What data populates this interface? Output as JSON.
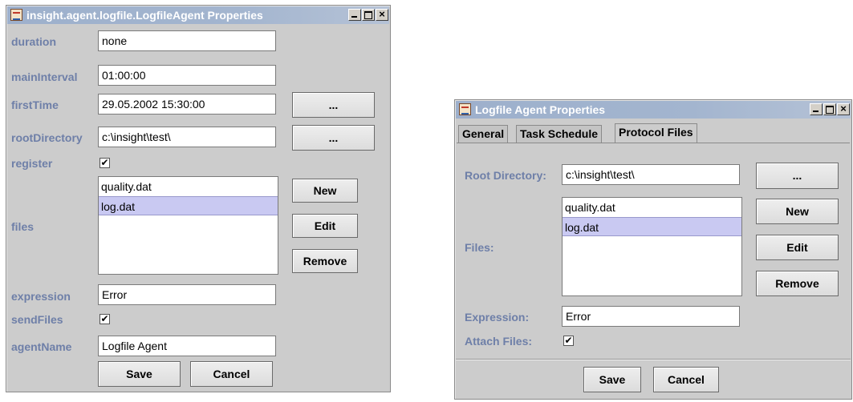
{
  "left_window": {
    "title": "insight.agent.logfile.LogfileAgent Properties",
    "controls": {
      "minimize": "_",
      "maximize": "□",
      "close": "×"
    },
    "labels": {
      "duration": "duration",
      "mainInterval": "mainInterval",
      "firstTime": "firstTime",
      "rootDirectory": "rootDirectory",
      "register": "register",
      "files": "files",
      "expression": "expression",
      "sendFiles": "sendFiles",
      "agentName": "agentName"
    },
    "values": {
      "duration": "none",
      "mainInterval": "01:00:00",
      "firstTime": "29.05.2002 15:30:00",
      "rootDirectory": "c:\\insight\\test\\",
      "expression": "Error",
      "agentName": "Logfile Agent"
    },
    "register_checked": "✔",
    "sendFiles_checked": "✔",
    "files": [
      "quality.dat",
      "log.dat"
    ],
    "selected_file": "log.dat",
    "buttons": {
      "browse_first_time": "...",
      "browse_root": "...",
      "new": "New",
      "edit": "Edit",
      "remove": "Remove",
      "save": "Save",
      "cancel": "Cancel"
    }
  },
  "right_window": {
    "title": "Logfile Agent Properties",
    "controls": {
      "minimize": "_",
      "maximize": "□",
      "close": "×"
    },
    "tabs": [
      "General",
      "Task Schedule",
      "Protocol Files"
    ],
    "active_tab": "Protocol Files",
    "labels": {
      "root_directory": "Root Directory:",
      "files": "Files:",
      "expression": "Expression:",
      "attach_files": "Attach Files:"
    },
    "values": {
      "root_directory": "c:\\insight\\test\\",
      "expression": "Error"
    },
    "attach_files_checked": "✔",
    "files": [
      "quality.dat",
      "log.dat"
    ],
    "selected_file": "log.dat",
    "buttons": {
      "browse_root": "...",
      "new": "New",
      "edit": "Edit",
      "remove": "Remove",
      "save": "Save",
      "cancel": "Cancel"
    }
  }
}
